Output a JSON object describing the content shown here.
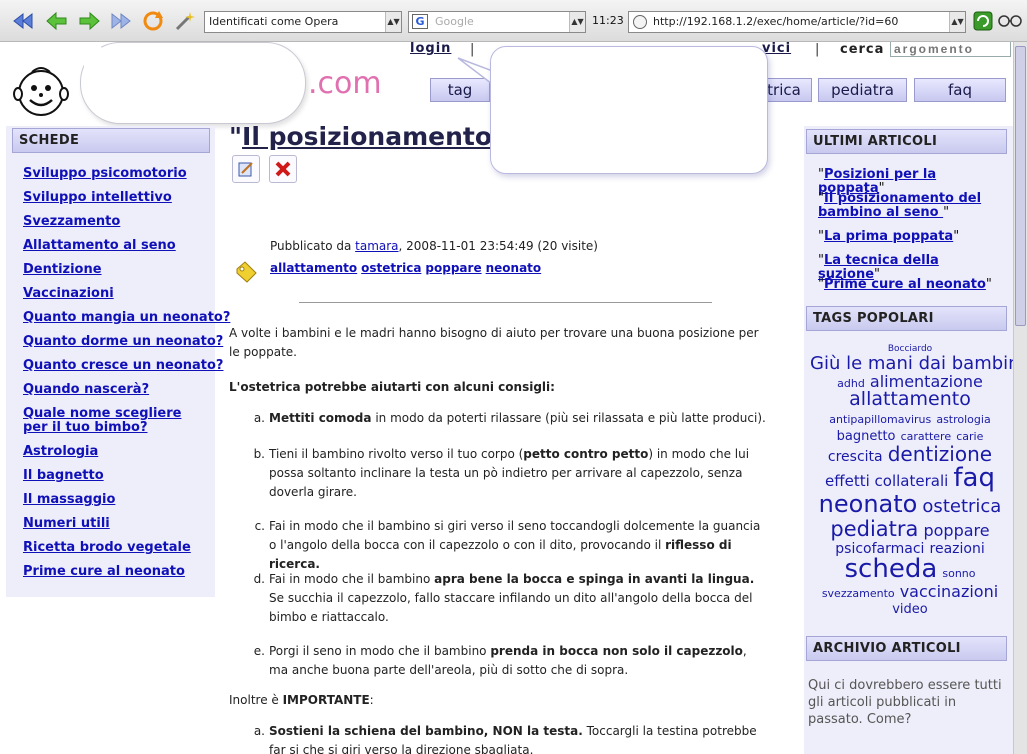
{
  "browser": {
    "identify": "Identificati come Opera",
    "search_engine_placeholder": "Google",
    "clock": "11:23",
    "url": "http://192.168.1.2/exec/home/article/?id=60"
  },
  "header": {
    "logo_tail": ".com",
    "login_label": "login",
    "nav_fragment": "vici",
    "cerca_label": "cerca",
    "search_placeholder": "argomento",
    "tabs": [
      "tag",
      "trica",
      "pediatra",
      "faq"
    ]
  },
  "left": {
    "title": "SCHEDE",
    "items": [
      "Sviluppo psicomotorio",
      "Sviluppo intellettivo",
      "Svezzamento",
      "Allattamento al seno",
      "Dentizione",
      "Vaccinazioni",
      "Quanto mangia un neonato?",
      "Quanto dorme un neonato?",
      "Quanto cresce un neonato?",
      "Quando nascerà?",
      "Quale nome scegliere per il tuo bimbo?",
      "Astrologia",
      "Il bagnetto",
      "Il massaggio",
      "Numeri utili",
      "Ricetta brodo vegetale",
      "Prime cure al neonato"
    ]
  },
  "article": {
    "title_prefix": "\"",
    "title_visible": "Il posizionamento d",
    "published_prefix": "Pubblicato da ",
    "author": "tamara",
    "published_suffix": ", 2008-11-01 23:54:49 (20 visite)",
    "tags": [
      "allattamento",
      "ostetrica",
      "poppare",
      "neonato"
    ],
    "intro": "A volte i bambini e le madri hanno bisogno di aiuto per trovare una buona posizione per le poppate.",
    "advice_heading": "L'ostetrica potrebbe aiutarti con alcuni consigli:",
    "items": [
      {
        "n": "a.",
        "b1": "Mettiti comoda",
        "t1": " in modo da poterti rilassare (più sei rilassata e più latte produci).",
        "b2": "",
        "t2": ""
      },
      {
        "n": "b.",
        "b1": "",
        "t1": "Tieni il bambino rivolto verso il tuo corpo (",
        "b2": "petto contro petto",
        "t2": ") in modo che lui possa soltanto inclinare la testa un pò indietro per arrivare al capezzolo, senza doverla girare."
      },
      {
        "n": "c.",
        "b1": "",
        "t1": "Fai in modo che il bambino si giri verso il seno toccandogli dolcemente la guancia o l'angolo della bocca con il capezzolo o con il dito, provocando il ",
        "b2": "riflesso di ricerca.",
        "t2": ""
      },
      {
        "n": "d.",
        "b1": "",
        "t1": "Fai in modo che il bambino ",
        "b2": "apra bene la bocca e spinga in avanti la lingua.",
        "t2": " Se succhia il capezzolo, fallo staccare infilando un dito all'angolo della bocca del bimbo e riattaccalo."
      },
      {
        "n": "e.",
        "b1": "",
        "t1": "Porgi il seno in modo che il bambino ",
        "b2": "prenda in bocca non solo il capezzolo",
        "t2": ", ma anche buona parte dell'areola, più di sotto che di sopra."
      }
    ],
    "important_prefix": "Inoltre è ",
    "important_bold": "IMPORTANTE",
    "important_suffix": ":",
    "item2": {
      "n": "a.",
      "b1": "Sostieni la schiena del bambino, NON la testa.",
      "t1": " Toccargli la testina potrebbe far si che si giri verso la direzione sbagliata."
    }
  },
  "right": {
    "latest_title": "ULTIMI ARTICOLI",
    "latest": [
      "Posizioni per la poppata",
      "Il posizionamento del bambino al seno ",
      "La prima poppata",
      "La tecnica della suzione",
      "Prime cure al neonato"
    ],
    "tags_title": "TAGS POPOLARI",
    "tag_cloud": [
      {
        "t": "Bocciardo",
        "s": 9
      },
      {
        "t": "Giù le mani dai bambini",
        "s": 18
      },
      {
        "t": "adhd",
        "s": 11
      },
      {
        "t": "alimentazione",
        "s": 16
      },
      {
        "t": "allattamento",
        "s": 19
      },
      {
        "t": "antipapillomavirus",
        "s": 11
      },
      {
        "t": "astrologia",
        "s": 11
      },
      {
        "t": "bagnetto",
        "s": 13
      },
      {
        "t": "carattere",
        "s": 11
      },
      {
        "t": "carie",
        "s": 11
      },
      {
        "t": "crescita",
        "s": 14
      },
      {
        "t": "dentizione",
        "s": 20
      },
      {
        "t": "effetti collaterali",
        "s": 15
      },
      {
        "t": "faq",
        "s": 26
      },
      {
        "t": "neonato",
        "s": 24
      },
      {
        "t": "ostetrica",
        "s": 18
      },
      {
        "t": "pediatra",
        "s": 21
      },
      {
        "t": "poppare",
        "s": 16
      },
      {
        "t": "psicofarmaci",
        "s": 14
      },
      {
        "t": "reazioni",
        "s": 14
      },
      {
        "t": "scheda",
        "s": 26
      },
      {
        "t": "sonno",
        "s": 11
      },
      {
        "t": "svezzamento",
        "s": 11
      },
      {
        "t": "vaccinazioni",
        "s": 16
      },
      {
        "t": "video",
        "s": 13
      }
    ],
    "archive_title": "ARCHIVIO ARTICOLI",
    "archive_text": "Qui ci dovrebbero essere tutti gli articoli pubblicati in passato. Come?"
  }
}
